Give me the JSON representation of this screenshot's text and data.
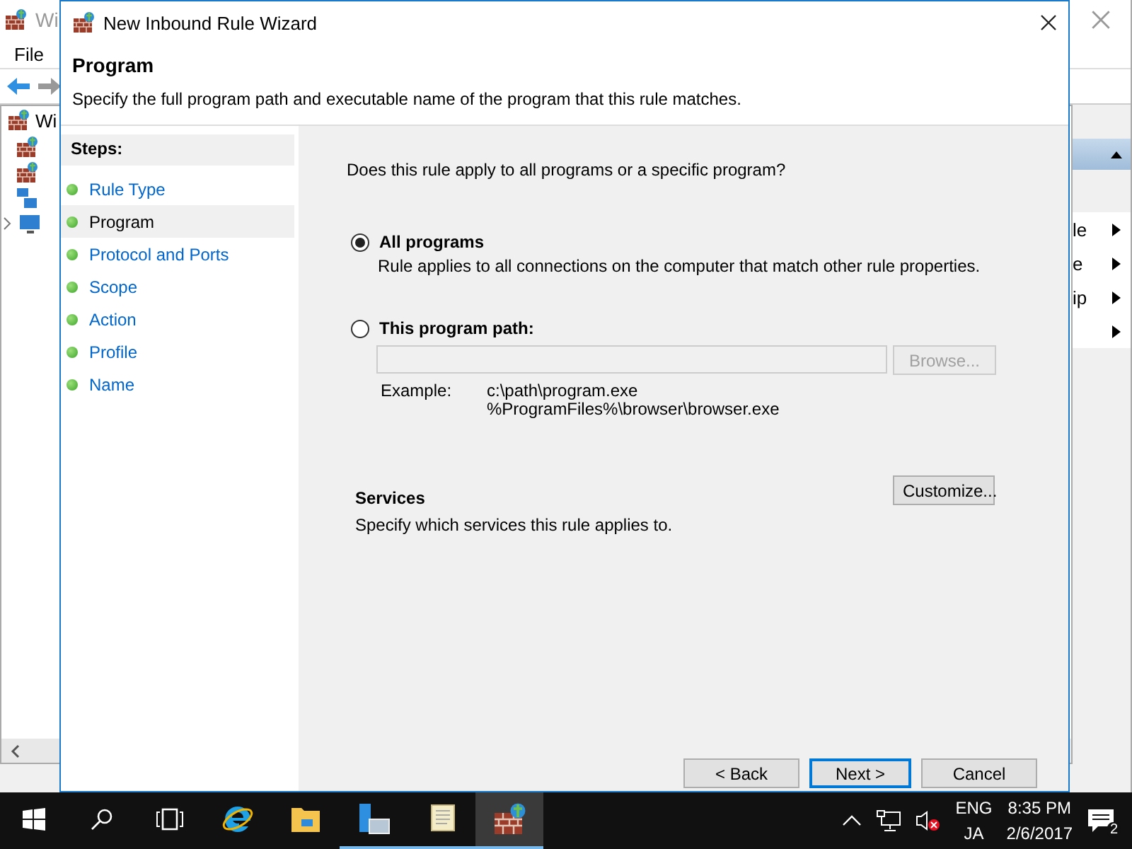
{
  "background_window": {
    "title": "Wi",
    "menu": [
      "File"
    ],
    "tree_root": "Wi",
    "actions": [
      {
        "kind": "header"
      },
      {
        "kind": "submenu",
        "label": "le"
      },
      {
        "kind": "submenu",
        "label": "e"
      },
      {
        "kind": "submenu",
        "label": "ip"
      },
      {
        "kind": "submenu"
      }
    ]
  },
  "wizard": {
    "title": "New Inbound Rule Wizard",
    "heading": "Program",
    "description": "Specify the full program path and executable name of the program that this rule matches.",
    "steps_title": "Steps:",
    "steps": [
      {
        "label": "Rule Type",
        "selected": false
      },
      {
        "label": "Program",
        "selected": true
      },
      {
        "label": "Protocol and Ports",
        "selected": false
      },
      {
        "label": "Scope",
        "selected": false
      },
      {
        "label": "Action",
        "selected": false
      },
      {
        "label": "Profile",
        "selected": false
      },
      {
        "label": "Name",
        "selected": false
      }
    ],
    "question": "Does this rule apply to all programs or a specific program?",
    "options": [
      {
        "label": "All programs",
        "description": "Rule applies to all connections on the computer that match other rule properties.",
        "selected": true
      },
      {
        "label": "This program path:",
        "selected": false
      }
    ],
    "program_path": {
      "disabled": true
    },
    "browse_button": {
      "label": "Browse...",
      "disabled": true
    },
    "example_label": "Example:",
    "example_paths": [
      "c:\\path\\program.exe",
      "%ProgramFiles%\\browser\\browser.exe"
    ],
    "services": {
      "title": "Services",
      "description": "Specify which services this rule applies to.",
      "button": "Customize..."
    },
    "buttons": [
      {
        "label": "< Back",
        "default": false
      },
      {
        "label": "Next >",
        "default": true
      },
      {
        "label": "Cancel",
        "default": false
      }
    ]
  },
  "taskbar": {
    "apps": [
      {
        "kind": "start",
        "running": false,
        "selected": false
      },
      {
        "kind": "search",
        "running": false,
        "selected": false
      },
      {
        "kind": "taskview",
        "running": false,
        "selected": false
      },
      {
        "kind": "browser",
        "running": false,
        "selected": false
      },
      {
        "kind": "folder",
        "running": false,
        "selected": false
      },
      {
        "kind": "server",
        "running": true,
        "selected": false
      },
      {
        "kind": "scroll",
        "running": true,
        "selected": false
      },
      {
        "kind": "firewall",
        "running": true,
        "selected": true
      }
    ],
    "language": [
      "ENG",
      "JA"
    ],
    "time": "8:35 PM",
    "date": "2/6/2017",
    "notification_count": "2"
  }
}
